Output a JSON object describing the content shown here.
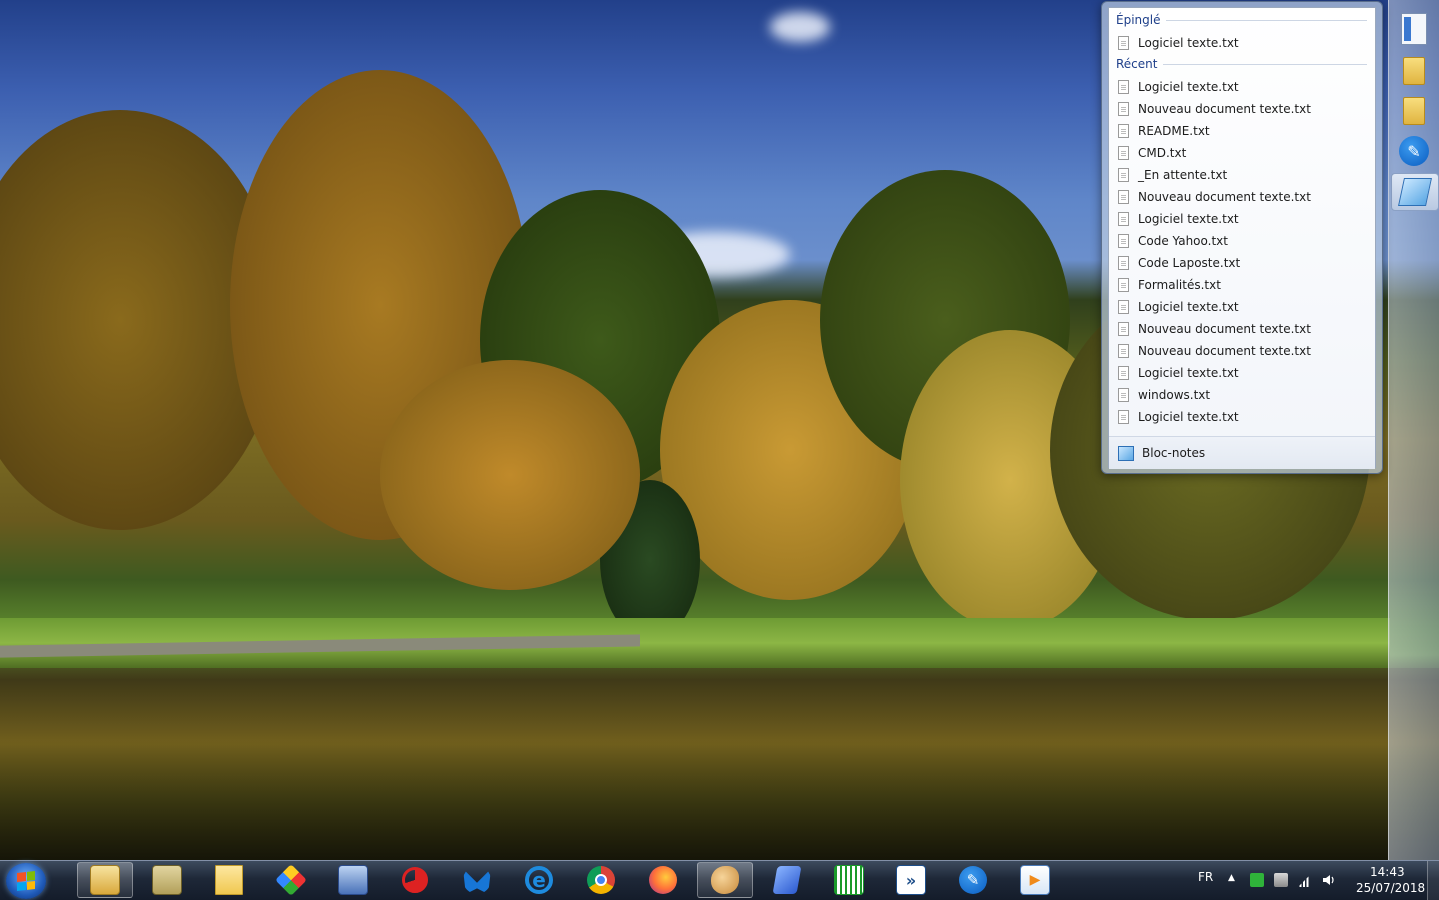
{
  "jump_list": {
    "pinned_header": "Épinglé",
    "pinned": [
      "Logiciel texte.txt"
    ],
    "recent_header": "Récent",
    "recent": [
      "Logiciel texte.txt",
      "Nouveau document texte.txt",
      "README.txt",
      "CMD.txt",
      "_En attente.txt",
      "Nouveau document texte.txt",
      "Logiciel texte.txt",
      "Code Yahoo.txt",
      "Code Laposte.txt",
      "Formalités.txt",
      "Logiciel texte.txt",
      "Nouveau document texte.txt",
      "Nouveau document texte.txt",
      "Logiciel texte.txt",
      "windows.txt",
      "Logiciel texte.txt"
    ],
    "app_name": "Bloc-notes"
  },
  "taskbar": {
    "pinned_icons": [
      "explorer-icon",
      "folder-sync-icon",
      "notes-icon",
      "cube-app-icon",
      "cloud-app-icon",
      "ccleaner-icon",
      "malwarebytes-icon",
      "internet-explorer-icon",
      "chrome-icon",
      "firefox-icon",
      "paint-icon",
      "book-icon",
      "spreadsheet-icon",
      "remote-arrow-icon",
      "pen-icon",
      "video-icon"
    ],
    "ie_glyph": "e",
    "pen_glyph": "✎",
    "video_glyph": "▶",
    "arrow_glyph": "»"
  },
  "tray": {
    "language": "FR",
    "time": "14:43",
    "date": "25/07/2018",
    "overflow_glyph": "▲"
  },
  "dock": {
    "pen_glyph": "✎"
  }
}
